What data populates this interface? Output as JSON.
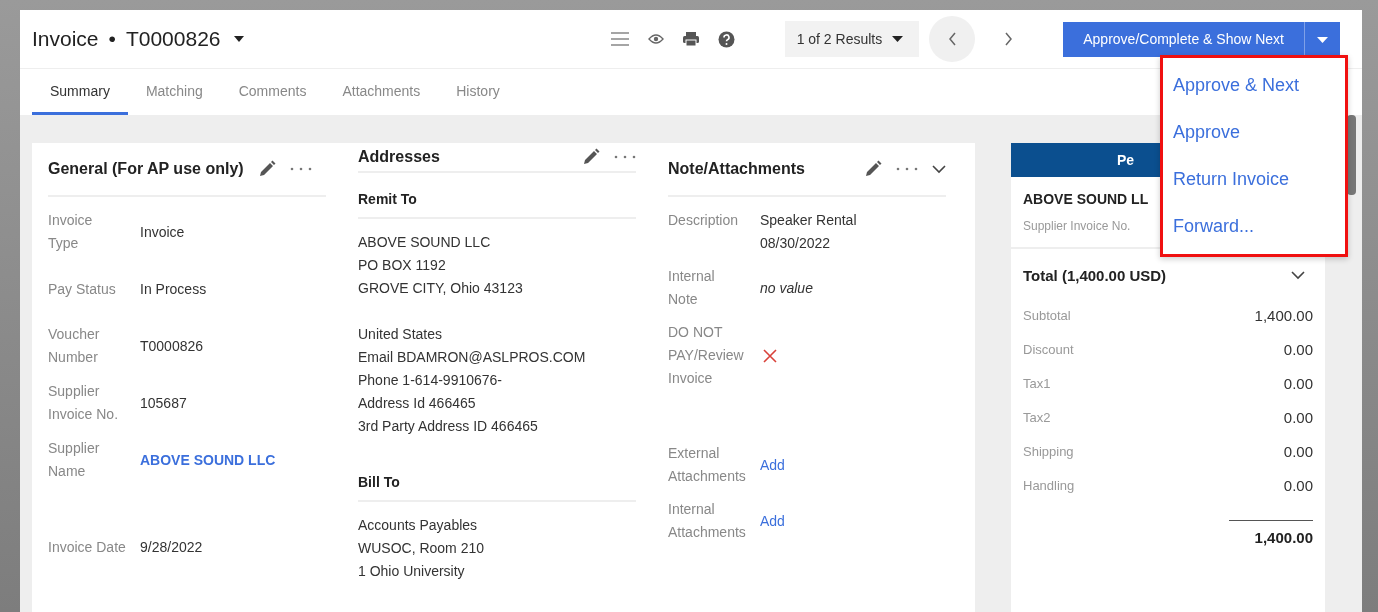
{
  "header": {
    "doc_type": "Invoice",
    "separator": "•",
    "doc_number": "T0000826",
    "results": "1 of 2 Results",
    "primary_action": "Approve/Complete & Show Next"
  },
  "tabs": [
    {
      "label": "Summary",
      "selected": true
    },
    {
      "label": "Matching",
      "selected": false
    },
    {
      "label": "Comments",
      "selected": false
    },
    {
      "label": "Attachments",
      "selected": false
    },
    {
      "label": "History",
      "selected": false
    }
  ],
  "general": {
    "title": "General (For AP use only)",
    "fields": [
      {
        "label": "Invoice Type",
        "value": "Invoice",
        "kind": "text"
      },
      {
        "label": "Pay Status",
        "value": "In Process",
        "kind": "text"
      },
      {
        "label": "Voucher Number",
        "value": "T0000826",
        "kind": "text"
      },
      {
        "label": "Supplier Invoice No.",
        "value": "105687",
        "kind": "text"
      },
      {
        "label": "Supplier Name",
        "value": "ABOVE SOUND LLC",
        "kind": "link"
      },
      {
        "label": "Invoice Date",
        "value": "9/28/2022",
        "kind": "text"
      }
    ]
  },
  "addresses": {
    "title": "Addresses",
    "sections": [
      {
        "heading": "Remit To",
        "blocks": [
          [
            "ABOVE SOUND LLC",
            "PO BOX 1192",
            "GROVE CITY, Ohio 43123"
          ],
          [
            "United States",
            "Email BDAMRON@ASLPROS.COM",
            "Phone 1-614-9910676-",
            "Address Id 466465",
            "3rd Party Address ID 466465"
          ]
        ]
      },
      {
        "heading": "Bill To",
        "blocks": [
          [
            "Accounts Payables",
            "WUSOC, Room 210",
            "1 Ohio University"
          ]
        ]
      }
    ]
  },
  "notes": {
    "title": "Note/Attachments",
    "fields": [
      {
        "label": "Description",
        "value": "Speaker Rental 08/30/2022",
        "kind": "text"
      },
      {
        "label": "Internal Note",
        "value": "no value",
        "kind": "empty"
      },
      {
        "label": "DO NOT PAY/Review Invoice",
        "checked": false,
        "kind": "flag"
      },
      {
        "label": "External Attachments",
        "value": "Add",
        "kind": "link"
      },
      {
        "label": "Internal Attachments",
        "value": "Add",
        "kind": "link"
      }
    ]
  },
  "summary_panel": {
    "banner": "Pe",
    "supplier": "ABOVE SOUND LL",
    "supplier_invoice_label": "Supplier Invoice No.",
    "total_title": "Total (1,400.00 USD)",
    "rows": [
      {
        "label": "Subtotal",
        "value": "1,400.00"
      },
      {
        "label": "Discount",
        "value": "0.00"
      },
      {
        "label": "Tax1",
        "value": "0.00"
      },
      {
        "label": "Tax2",
        "value": "0.00"
      },
      {
        "label": "Shipping",
        "value": "0.00"
      },
      {
        "label": "Handling",
        "value": "0.00"
      }
    ],
    "grand_total": "1,400.00"
  },
  "action_menu": {
    "items": [
      "Approve & Next",
      "Approve",
      "Return Invoice",
      "Forward..."
    ]
  }
}
